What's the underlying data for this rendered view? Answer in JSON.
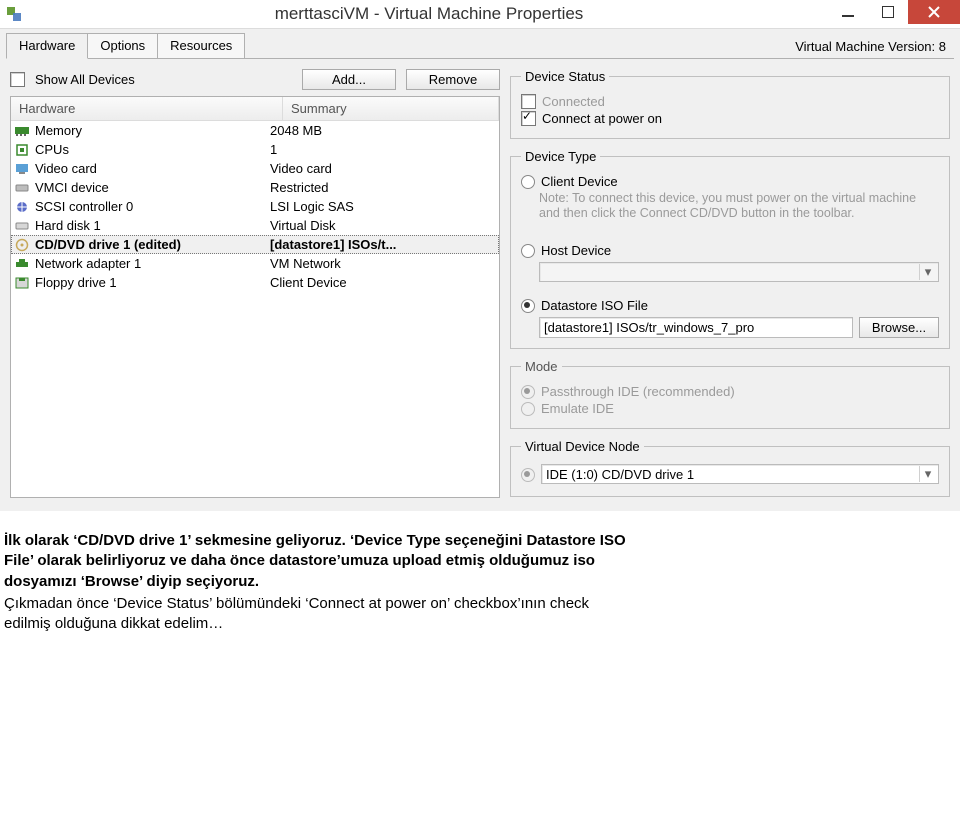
{
  "window": {
    "title": "merttasciVM - Virtual Machine Properties"
  },
  "tabs": [
    "Hardware",
    "Options",
    "Resources"
  ],
  "version_label": "Virtual Machine Version: 8",
  "left": {
    "show_all": "Show All Devices",
    "add_btn": "Add...",
    "remove_btn": "Remove",
    "col_hardware": "Hardware",
    "col_summary": "Summary",
    "rows": [
      {
        "name": "Memory",
        "summary": "2048 MB"
      },
      {
        "name": "CPUs",
        "summary": "1"
      },
      {
        "name": "Video card",
        "summary": "Video card"
      },
      {
        "name": "VMCI device",
        "summary": "Restricted"
      },
      {
        "name": "SCSI controller 0",
        "summary": "LSI Logic SAS"
      },
      {
        "name": "Hard disk 1",
        "summary": "Virtual Disk"
      },
      {
        "name": "CD/DVD drive 1 (edited)",
        "summary": "[datastore1] ISOs/t..."
      },
      {
        "name": "Network adapter 1",
        "summary": "VM Network"
      },
      {
        "name": "Floppy drive 1",
        "summary": "Client Device"
      }
    ]
  },
  "device_status": {
    "legend": "Device Status",
    "connected": "Connected",
    "connect_power": "Connect at power on"
  },
  "device_type": {
    "legend": "Device Type",
    "client": "Client Device",
    "client_note": "Note: To connect this device, you must power on the virtual machine and then click the Connect CD/DVD button in the toolbar.",
    "host": "Host Device",
    "host_value": "",
    "datastore": "Datastore ISO File",
    "datastore_value": "[datastore1] ISOs/tr_windows_7_pro",
    "browse": "Browse..."
  },
  "mode": {
    "legend": "Mode",
    "pass": "Passthrough IDE (recommended)",
    "emu": "Emulate IDE"
  },
  "vdn": {
    "legend": "Virtual Device Node",
    "value": "IDE (1:0) CD/DVD drive 1"
  },
  "footer": {
    "l1": "İlk olarak ‘CD/DVD drive 1’ sekmesine geliyoruz. ‘Device Type seçeneğini Datastore ISO",
    "l2": "File’ olarak belirliyoruz ve daha önce datastore’umuza upload etmiş olduğumuz iso",
    "l3": "dosyamızı ‘Browse’ diyip seçiyoruz.",
    "l4": "Çıkmadan önce ‘Device Status’ bölümündeki ‘Connect at power on’ checkbox’ının check",
    "l5": "edilmiş olduğuna dikkat edelim…"
  },
  "icons": {
    "memory": "#3a8a2e",
    "cpu": "#3a8a2e",
    "video": "#5aa0d6",
    "vmci": "#888",
    "scsi": "#5a6cc8",
    "disk": "#999",
    "cd": "#c7a95a",
    "net": "#3a8a2e",
    "floppy": "#3a8a2e"
  }
}
